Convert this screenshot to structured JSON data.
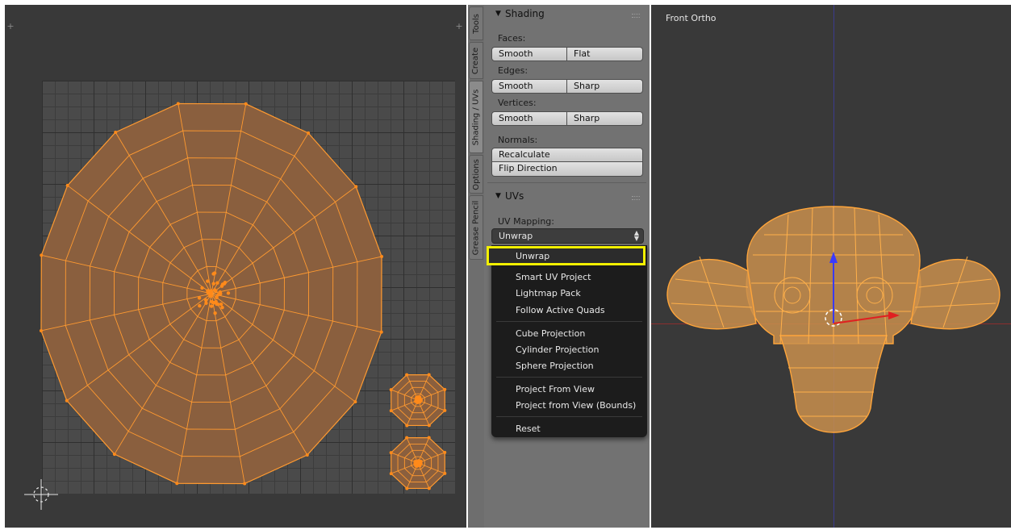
{
  "uv_editor": {},
  "tool_tabs": [
    "Tools",
    "Create",
    "Shading / UVs",
    "Options",
    "Grease Pencil"
  ],
  "shading_panel": {
    "title": "Shading",
    "faces_label": "Faces:",
    "faces_smooth": "Smooth",
    "faces_flat": "Flat",
    "edges_label": "Edges:",
    "edges_smooth": "Smooth",
    "edges_sharp": "Sharp",
    "vertices_label": "Vertices:",
    "vertices_smooth": "Smooth",
    "vertices_sharp": "Sharp",
    "normals_label": "Normals:",
    "recalculate": "Recalculate",
    "flip_direction": "Flip Direction"
  },
  "uvs_panel": {
    "title": "UVs",
    "mapping_label": "UV Mapping:",
    "mapping_value": "Unwrap"
  },
  "unwrap_menu": {
    "items": [
      "Unwrap",
      "Smart UV Project",
      "Lightmap Pack",
      "Follow Active Quads",
      "Cube Projection",
      "Cylinder Projection",
      "Sphere Projection",
      "Project From View",
      "Project from View (Bounds)",
      "Reset"
    ],
    "highlighted": "Unwrap",
    "highlight_color": "#f3f000"
  },
  "viewport": {
    "view_label": "Front Ortho"
  },
  "colors": {
    "mesh_fill": "#8a5f3e",
    "mesh_edge": "#ff9a30",
    "selected_vertex": "#ff8a1a"
  }
}
